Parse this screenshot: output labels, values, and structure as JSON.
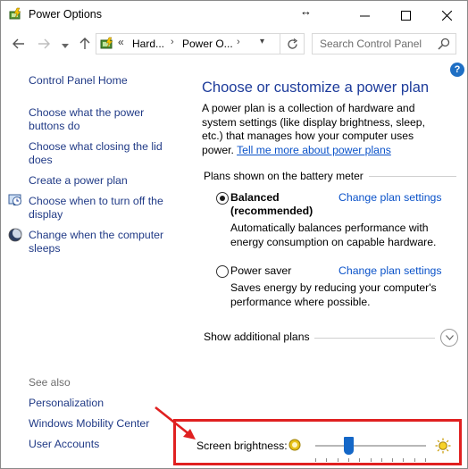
{
  "window": {
    "title": "Power Options",
    "resize_cursor": "↔"
  },
  "navigation": {
    "breadcrumb_prefix": "«",
    "crumbs": [
      "Hard...",
      "Power O..."
    ],
    "search_placeholder": "Search Control Panel"
  },
  "sidebar": {
    "home": "Control Panel Home",
    "tasks": [
      {
        "label": "Choose what the power buttons do",
        "icon": null
      },
      {
        "label": "Choose what closing the lid does",
        "icon": null
      },
      {
        "label": "Create a power plan",
        "icon": null
      },
      {
        "label": "Choose when to turn off the display",
        "icon": "monitor-clock-icon"
      },
      {
        "label": "Change when the computer sleeps",
        "icon": "moon-icon"
      }
    ],
    "see_also_label": "See also",
    "see_also": [
      "Personalization",
      "Windows Mobility Center",
      "User Accounts"
    ]
  },
  "main": {
    "heading": "Choose or customize a power plan",
    "intro_text": "A power plan is a collection of hardware and system settings (like display brightness, sleep, etc.) that manages how your computer uses power.",
    "intro_link": "Tell me more about power plans",
    "group_label": "Plans shown on the battery meter",
    "plans": [
      {
        "name_line1": "Balanced",
        "name_line2": "(recommended)",
        "selected": true,
        "change_label": "Change plan settings",
        "description": "Automatically balances performance with energy consumption on capable hardware."
      },
      {
        "name_line1": "Power saver",
        "selected": false,
        "change_label": "Change plan settings",
        "description": "Saves energy by reducing your computer's performance where possible."
      }
    ],
    "show_more": "Show additional plans"
  },
  "brightness": {
    "label": "Screen brightness:",
    "level_fraction": 0.3
  },
  "colors": {
    "link": "#0a52c9",
    "heading": "#1e3c9b",
    "highlight": "#e02020",
    "slider_thumb": "#1467c7"
  }
}
